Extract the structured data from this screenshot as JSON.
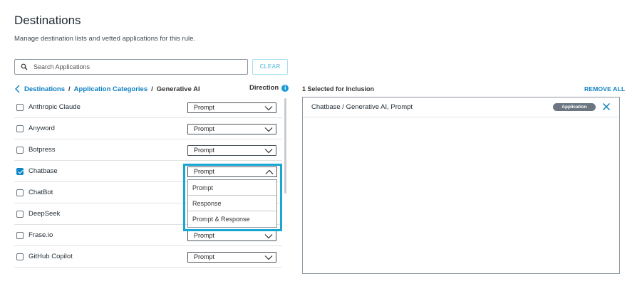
{
  "page": {
    "title": "Destinations",
    "subtitle": "Manage destination lists and vetted applications for this rule."
  },
  "search": {
    "placeholder": "Search Applications",
    "value": ""
  },
  "clear_label": "CLEAR",
  "breadcrumb": {
    "items": [
      "Destinations",
      "Application Categories",
      "Generative AI"
    ],
    "separator": "/"
  },
  "direction_label": "Direction",
  "applications": [
    {
      "name": "Anthropic Claude",
      "checked": false,
      "direction": "Prompt"
    },
    {
      "name": "Anyword",
      "checked": false,
      "direction": "Prompt"
    },
    {
      "name": "Botpress",
      "checked": false,
      "direction": "Prompt"
    },
    {
      "name": "Chatbase",
      "checked": true,
      "direction": "Prompt"
    },
    {
      "name": "ChatBot",
      "checked": false,
      "direction": ""
    },
    {
      "name": "DeepSeek",
      "checked": false,
      "direction": ""
    },
    {
      "name": "Frase.io",
      "checked": false,
      "direction": "Prompt"
    },
    {
      "name": "GitHub Copilot",
      "checked": false,
      "direction": "Prompt"
    }
  ],
  "open_dropdown": {
    "selected": "Prompt",
    "options": [
      "Prompt",
      "Response",
      "Prompt & Response"
    ]
  },
  "selection": {
    "title": "1 Selected for Inclusion",
    "remove_all": "REMOVE ALL",
    "items": [
      {
        "label": "Chatbase / Generative AI, Prompt",
        "badge": "Application"
      }
    ]
  },
  "colors": {
    "accent": "#0b7fbf",
    "focus_ring": "#18a7d3",
    "badge": "#6b7680"
  }
}
